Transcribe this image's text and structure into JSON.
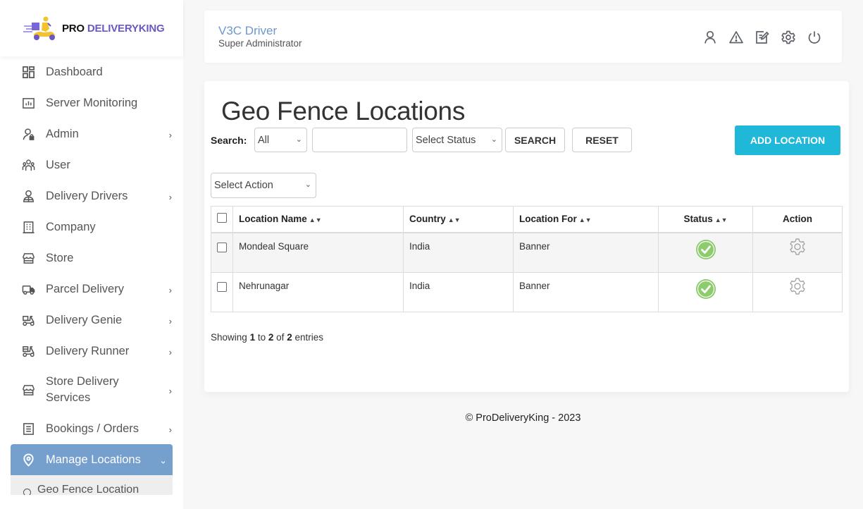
{
  "brand": {
    "pro": "PRO",
    "name": "DELIVERYKING",
    "accent": "#6a58c4"
  },
  "header": {
    "user_name": "V3C Driver",
    "user_role": "Super Administrator",
    "icons": [
      "profile-icon",
      "alert-icon",
      "edit-note-icon",
      "settings-icon",
      "power-icon"
    ]
  },
  "sidebar": {
    "active_color": "#759fcd",
    "items": [
      {
        "label": "Dashboard",
        "icon": "dashboard-icon",
        "has_submenu": false
      },
      {
        "label": "Server Monitoring",
        "icon": "chart-icon",
        "has_submenu": false
      },
      {
        "label": "Admin",
        "icon": "admin-lock-icon",
        "has_submenu": true
      },
      {
        "label": "User",
        "icon": "users-icon",
        "has_submenu": false
      },
      {
        "label": "Delivery Drivers",
        "icon": "driver-icon",
        "has_submenu": true
      },
      {
        "label": "Company",
        "icon": "building-icon",
        "has_submenu": false
      },
      {
        "label": "Store",
        "icon": "store-icon",
        "has_submenu": false
      },
      {
        "label": "Parcel Delivery",
        "icon": "truck-icon",
        "has_submenu": true
      },
      {
        "label": "Delivery Genie",
        "icon": "scooter-icon",
        "has_submenu": true
      },
      {
        "label": "Delivery Runner",
        "icon": "runner-scooter-icon",
        "has_submenu": true
      },
      {
        "label": "Store Delivery Services",
        "icon": "store-icon",
        "has_submenu": true
      },
      {
        "label": "Bookings / Orders",
        "icon": "document-icon",
        "has_submenu": true
      },
      {
        "label": "Manage Locations",
        "icon": "location-pin-icon",
        "has_submenu": true,
        "active": true
      }
    ],
    "sub_items": [
      {
        "label": "Geo Fence Location"
      }
    ]
  },
  "main": {
    "title": "Geo Fence Locations",
    "search_label": "Search:",
    "search_field_select": "All",
    "search_input_value": "",
    "status_select": "Select Status",
    "search_button": "SEARCH",
    "reset_button": "RESET",
    "add_button": "ADD LOCATION",
    "add_button_color": "#1fb8d8",
    "action_select": "Select Action",
    "table": {
      "columns": [
        "Location Name",
        "Country",
        "Location For",
        "Status",
        "Action"
      ],
      "rows": [
        {
          "name": "Mondeal Square",
          "country": "India",
          "location_for": "Banner",
          "status": "active"
        },
        {
          "name": "Nehrunagar",
          "country": "India",
          "location_for": "Banner",
          "status": "active"
        }
      ]
    },
    "showing": {
      "prefix": "Showing",
      "from": "1",
      "to_word": "to",
      "to": "2",
      "of_word": "of",
      "total": "2",
      "suffix": "entries"
    }
  },
  "footer": {
    "text": "© ProDeliveryKing - 2023"
  }
}
